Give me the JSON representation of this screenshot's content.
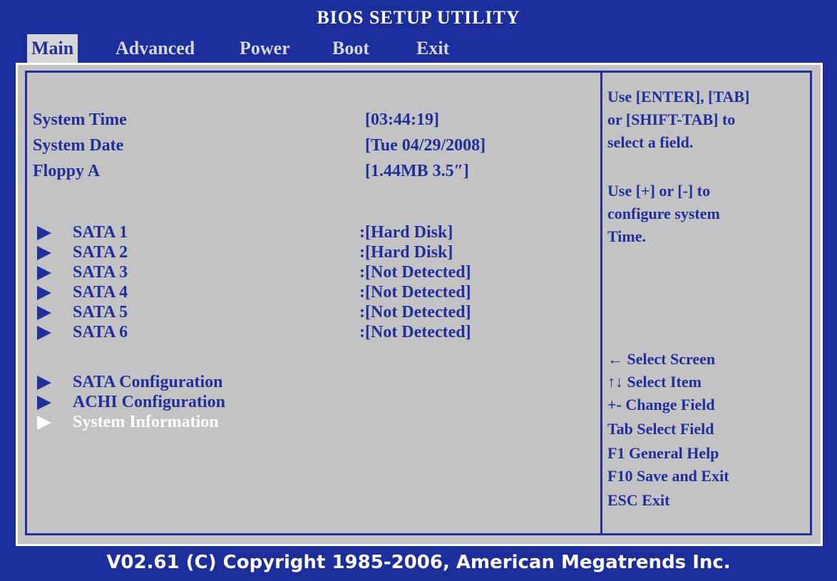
{
  "title": "BIOS SETUP UTILITY",
  "tabs": [
    "Main",
    "Advanced",
    "Power",
    "Boot",
    "Exit"
  ],
  "fields": {
    "system_time": {
      "label": "System Time",
      "value": "[03:44:19]"
    },
    "system_date": {
      "label": "System Date",
      "value": "[Tue 04/29/2008]"
    },
    "floppy_a": {
      "label": "Floppy A",
      "value": "[1.44MB 3.5″]"
    }
  },
  "sata": [
    {
      "label": "SATA 1",
      "value": ":[Hard Disk]"
    },
    {
      "label": "SATA 2",
      "value": ":[Hard Disk]"
    },
    {
      "label": "SATA 3",
      "value": ":[Not Detected]"
    },
    {
      "label": "SATA 4",
      "value": ":[Not Detected]"
    },
    {
      "label": "SATA 5",
      "value": ":[Not Detected]"
    },
    {
      "label": "SATA 6",
      "value": ":[Not Detected]"
    }
  ],
  "submenus": [
    "SATA Configuration",
    "ACHI Configuration",
    "System Information"
  ],
  "help": {
    "line1": "Use [ENTER], [TAB]",
    "line2": "or [SHIFT-TAB] to",
    "line3": "select a field.",
    "line4": "Use [+] or [-] to",
    "line5": "configure system",
    "line6": "Time."
  },
  "keys": {
    "k1": "← Select Screen",
    "k2": "↑↓ Select Item",
    "k3": "+- Change Field",
    "k4": "Tab Select Field",
    "k5": "F1 General Help",
    "k6": "F10 Save and Exit",
    "k7": "ESC Exit"
  },
  "footer": "V02.61 (C) Copyright 1985-2006, American Megatrends Inc."
}
